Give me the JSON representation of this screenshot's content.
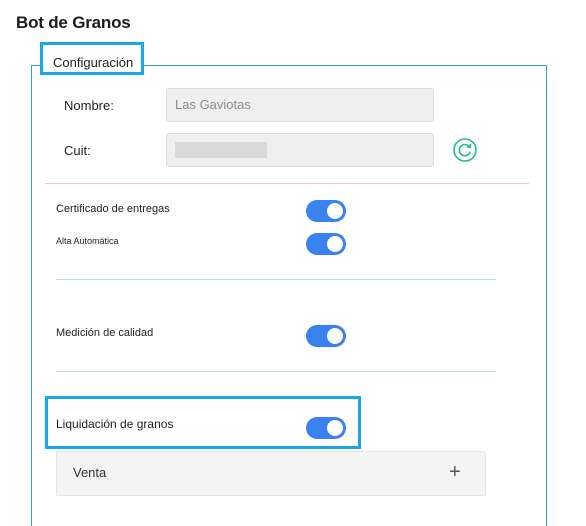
{
  "page": {
    "title": "Bot de Granos"
  },
  "config": {
    "legend": "Configuración",
    "nombre": {
      "label": "Nombre:",
      "value": "Las Gaviotas"
    },
    "cuit": {
      "label": "Cuit:",
      "value": ""
    },
    "refresh_icon": "refresh-icon",
    "toggles": [
      {
        "label": "Certificado de entregas",
        "on": true
      },
      {
        "label": "Alta Automática",
        "on": true
      },
      {
        "label": "Medición de calidad",
        "on": true
      },
      {
        "label": "Liquidación de granos",
        "on": true
      }
    ],
    "venta": {
      "label": "Venta",
      "icon": "plus-icon",
      "symbol": "+"
    }
  },
  "colors": {
    "accent": "#3a82f0",
    "highlight": "#18a8e8",
    "fieldset_border": "#2aa7b8"
  }
}
